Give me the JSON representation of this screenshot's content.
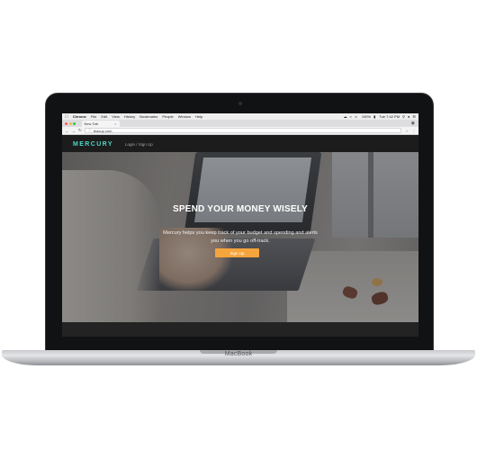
{
  "menubar": {
    "apple_icon": "apple-logo-icon",
    "items": [
      "Chrome",
      "File",
      "Edit",
      "View",
      "History",
      "Bookmarks",
      "People",
      "Window",
      "Help"
    ],
    "battery": "100%",
    "clock": "Tue 7:42 PM"
  },
  "browser": {
    "tab_title": "New Tab",
    "url": "teacup.com"
  },
  "site": {
    "logo": "MERCURY",
    "nav_link": "Login / Sign Up",
    "hero_title": "SPEND YOUR MONEY WISELY",
    "hero_subtitle": "Mercury helps you keep track of your budget and spending and alerts you when you go off-track.",
    "cta_label": "Sign Up"
  },
  "device": {
    "brand": "MacBook"
  },
  "colors": {
    "logo": "#4fd8c4",
    "cta": "#f5a53c",
    "nav_bg": "#1c1c1d"
  }
}
